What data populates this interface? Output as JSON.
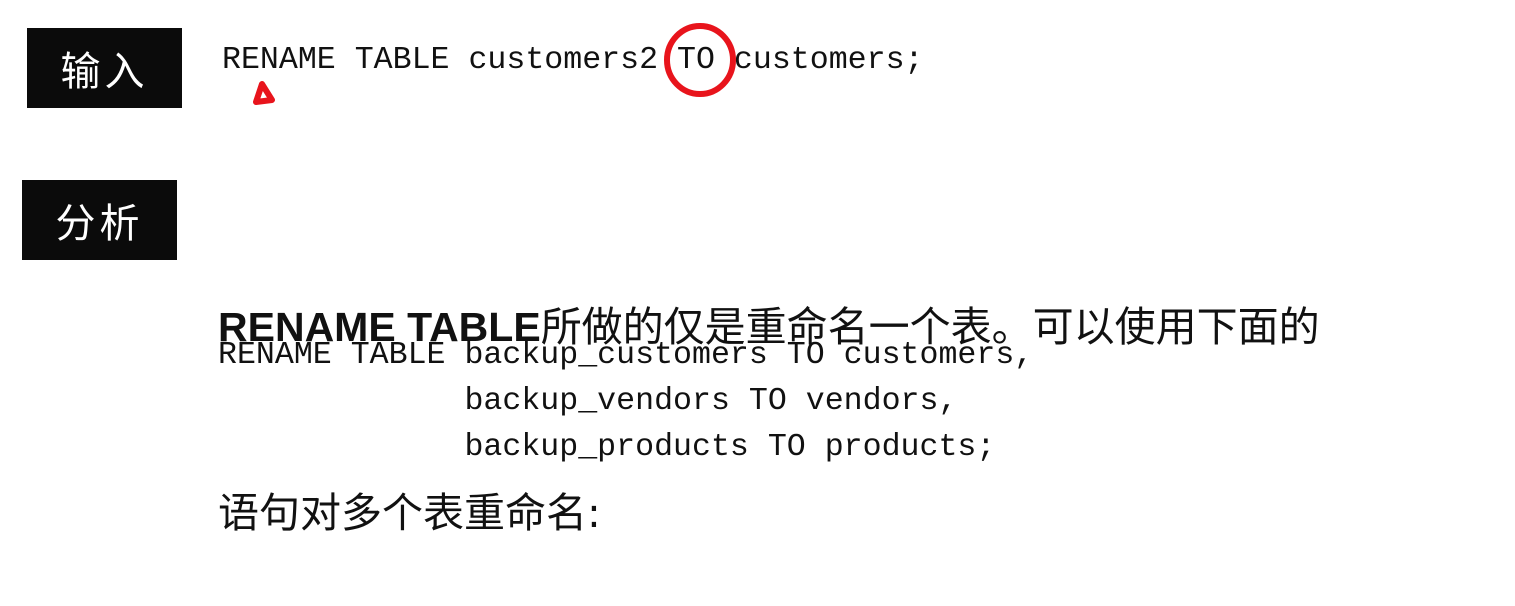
{
  "input_section": {
    "label": "输入",
    "code": "RENAME TABLE customers2 TO customers;"
  },
  "analysis_section": {
    "label": "分析",
    "paragraph_line1_keyword": "RENAME TABLE",
    "paragraph_line1_rest": "所做的仅是重命名一个表。可以使用下面的",
    "paragraph_line2": "语句对多个表重命名:",
    "code_lines": [
      "RENAME TABLE backup_customers TO customers,",
      "             backup_vendors TO vendors,",
      "             backup_products TO products;"
    ]
  },
  "annotations": {
    "color": "#e8141c",
    "circled_word": "TO"
  }
}
